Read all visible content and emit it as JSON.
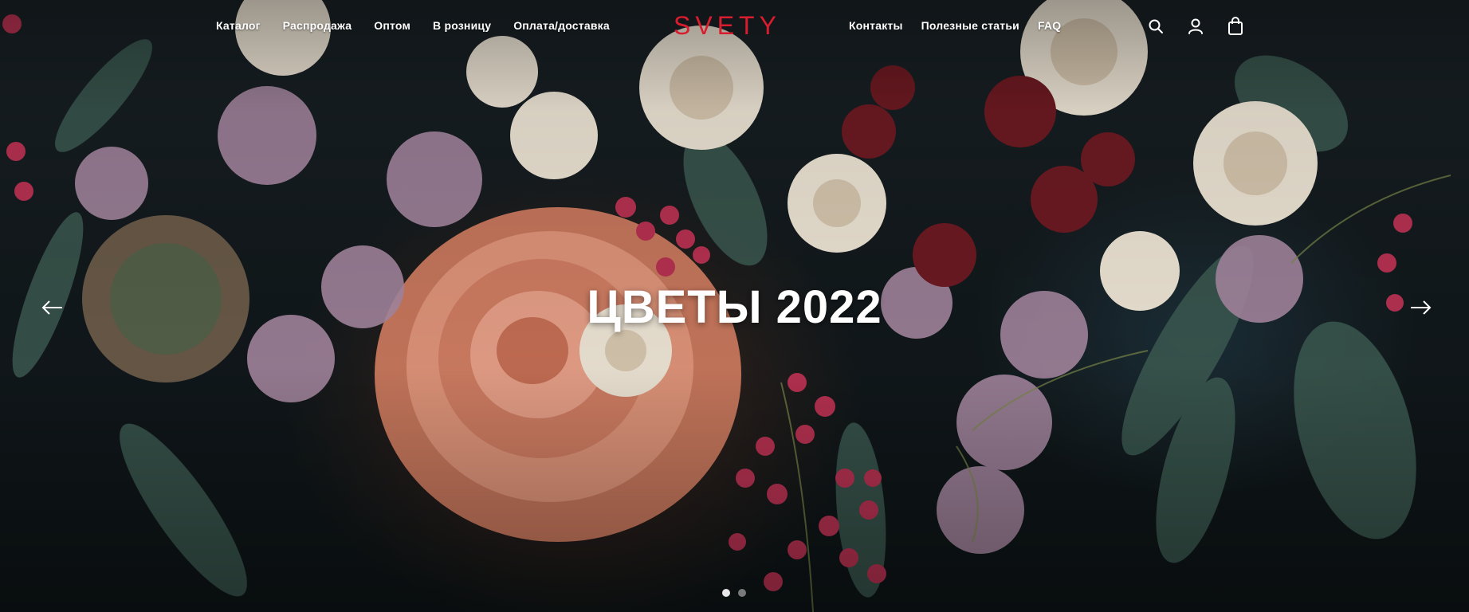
{
  "brand": {
    "logo": "SVETY",
    "logo_color": "#d91c2e"
  },
  "nav_left": [
    {
      "label": "Каталог"
    },
    {
      "label": "Распродажа"
    },
    {
      "label": "Оптом"
    },
    {
      "label": "В розницу"
    },
    {
      "label": "Оплата/доставка"
    }
  ],
  "nav_right": [
    {
      "label": "Контакты"
    },
    {
      "label": "Полезные статьи"
    },
    {
      "label": "FAQ"
    }
  ],
  "header_icons": [
    "search-icon",
    "user-icon",
    "shopping-bag-icon"
  ],
  "slider": {
    "headline": "ЦВЕТЫ 2022",
    "prev_icon": "arrow-left-icon",
    "next_icon": "arrow-right-icon",
    "slide_count": 2,
    "active_slide": 1
  },
  "colors": {
    "text": "#ffffff",
    "accent": "#d91c2e"
  }
}
